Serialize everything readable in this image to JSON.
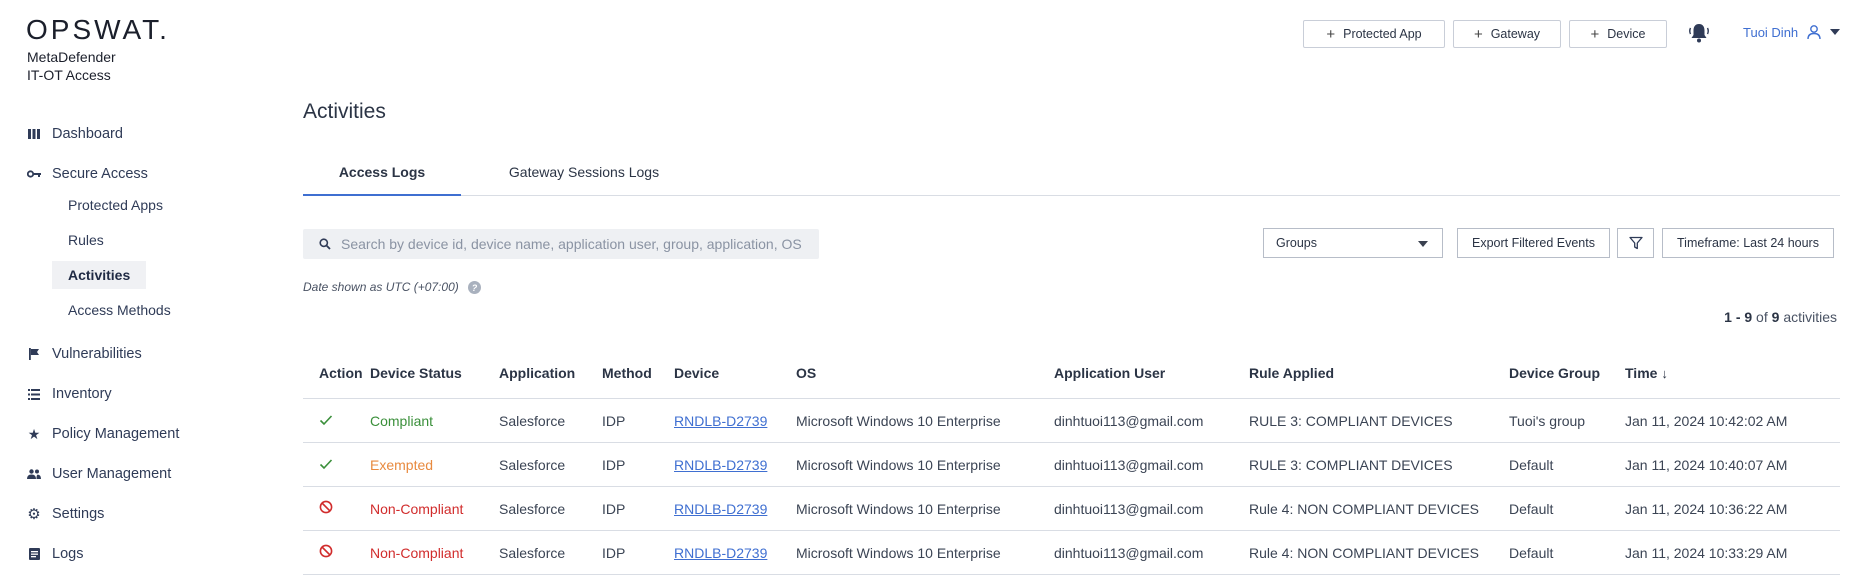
{
  "brand": {
    "logo": "OPSWAT.",
    "product_line1": "MetaDefender",
    "product_line2": "IT-OT Access"
  },
  "nav": {
    "dashboard": "Dashboard",
    "secure_access": "Secure Access",
    "sub": {
      "protected_apps": "Protected Apps",
      "rules": "Rules",
      "activities": "Activities",
      "access_methods": "Access Methods"
    },
    "vulnerabilities": "Vulnerabilities",
    "inventory": "Inventory",
    "policy_management": "Policy Management",
    "user_management": "User Management",
    "settings": "Settings",
    "logs": "Logs"
  },
  "header": {
    "protected_app": "Protected App",
    "gateway": "Gateway",
    "device": "Device",
    "user_name": "Tuoi Dinh"
  },
  "page": {
    "title": "Activities",
    "tabs": [
      "Access Logs",
      "Gateway Sessions Logs"
    ],
    "search_placeholder": "Search by device id, device name, application user, group, application, OS",
    "groups_select": "Groups",
    "export_button": "Export Filtered Events",
    "timeframe_button": "Timeframe: Last 24 hours",
    "date_note": "Date shown as UTC (+07:00)",
    "count": {
      "range": "1 - 9",
      "of": "of",
      "total": "9",
      "suffix": "activities"
    }
  },
  "table": {
    "headers": [
      "Action",
      "Device Status",
      "Application",
      "Method",
      "Device",
      "OS",
      "Application User",
      "Rule Applied",
      "Device Group",
      "Time"
    ],
    "rows": [
      {
        "action": "allowed",
        "status": "Compliant",
        "status_color": "green",
        "application": "Salesforce",
        "method": "IDP",
        "device": "RNDLB-D2739",
        "os": "Microsoft Windows 10 Enterprise",
        "user": "dinhtuoi113@gmail.com",
        "rule": "RULE 3: COMPLIANT DEVICES",
        "group": "Tuoi's group",
        "time": "Jan 11, 2024 10:42:02 AM"
      },
      {
        "action": "allowed",
        "status": "Exempted",
        "status_color": "orange",
        "application": "Salesforce",
        "method": "IDP",
        "device": "RNDLB-D2739",
        "os": "Microsoft Windows 10 Enterprise",
        "user": "dinhtuoi113@gmail.com",
        "rule": "RULE 3: COMPLIANT DEVICES",
        "group": "Default",
        "time": "Jan 11, 2024 10:40:07 AM"
      },
      {
        "action": "blocked",
        "status": "Non-Compliant",
        "status_color": "red",
        "application": "Salesforce",
        "method": "IDP",
        "device": "RNDLB-D2739",
        "os": "Microsoft Windows 10 Enterprise",
        "user": "dinhtuoi113@gmail.com",
        "rule": "Rule 4: NON COMPLIANT DEVICES",
        "group": "Default",
        "time": "Jan 11, 2024 10:36:22 AM"
      },
      {
        "action": "blocked",
        "status": "Non-Compliant",
        "status_color": "red",
        "application": "Salesforce",
        "method": "IDP",
        "device": "RNDLB-D2739",
        "os": "Microsoft Windows 10 Enterprise",
        "user": "dinhtuoi113@gmail.com",
        "rule": "Rule 4: NON COMPLIANT DEVICES",
        "group": "Default",
        "time": "Jan 11, 2024 10:33:29 AM"
      }
    ]
  },
  "colors": {
    "accent": "#3f6fd1",
    "green": "#3a8f3a",
    "orange": "#e88a3f",
    "red": "#d12c2c"
  }
}
